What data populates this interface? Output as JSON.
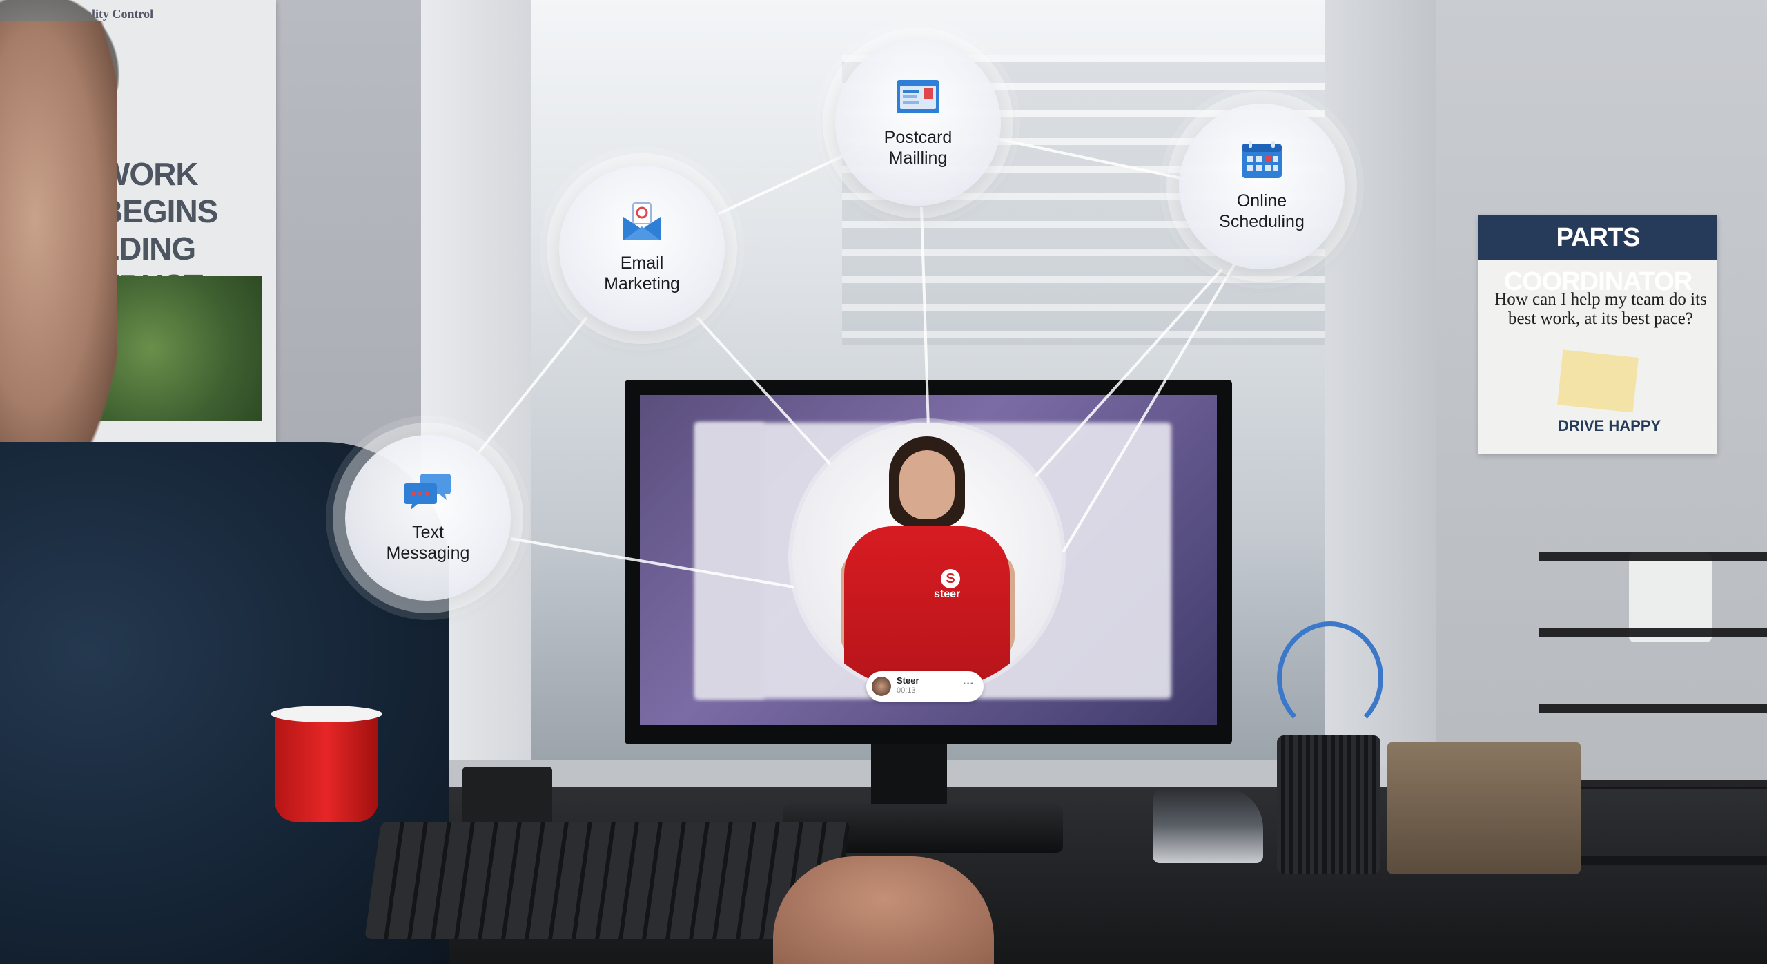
{
  "features": {
    "email": {
      "label_line1": "Email",
      "label_line2": "Marketing",
      "icon": "email-envelope-icon"
    },
    "postcard": {
      "label_line1": "Postcard",
      "label_line2": "Mailling",
      "icon": "postcard-icon"
    },
    "online": {
      "label_line1": "Online",
      "label_line2": "Scheduling",
      "icon": "calendar-icon"
    },
    "text": {
      "label_line1": "Text",
      "label_line2": "Messaging",
      "icon": "chat-bubbles-icon"
    }
  },
  "presenter": {
    "shirt_logo": "S",
    "shirt_brand": "steer",
    "card_name": "Steer",
    "card_time": "00:13",
    "card_more": "···"
  },
  "posters": {
    "left_heading": "Quality Control",
    "left_big_line1": "WORK BEGINS",
    "left_big_line2": "LDING TRUST",
    "right_banner": "PARTS COORDINATOR",
    "right_question": "How can I help my team do its best work, at its best pace?",
    "right_brand": "DRIVE HAPPY"
  },
  "colors": {
    "brand_red": "#d71c22",
    "icon_blue": "#2f7fd6",
    "banner_navy": "#253b59"
  }
}
